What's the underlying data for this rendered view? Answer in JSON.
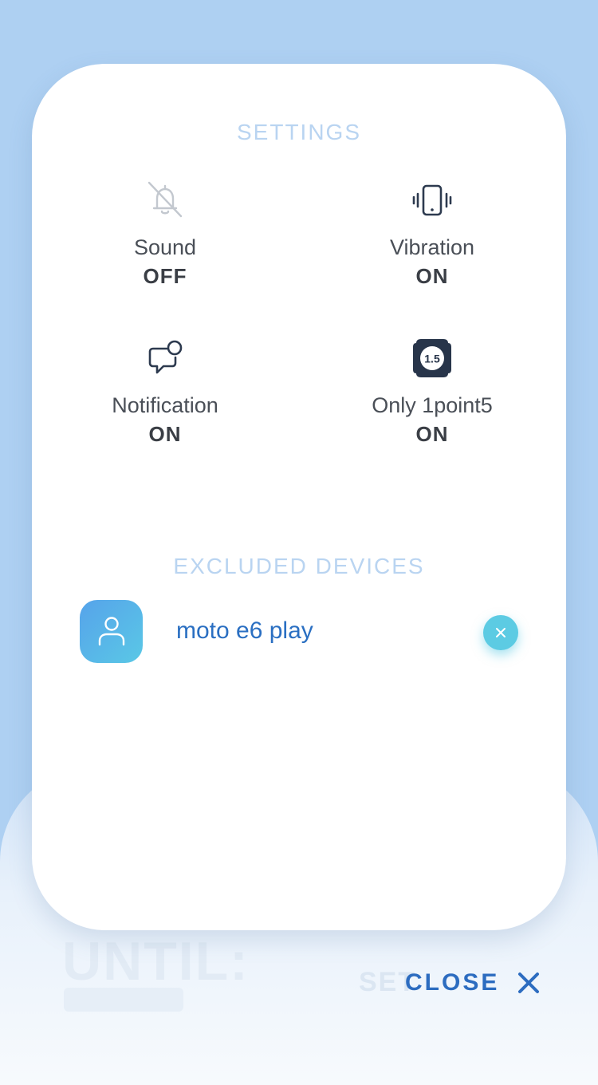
{
  "settings": {
    "title": "SETTINGS",
    "items": [
      {
        "label": "Sound",
        "value": "OFF",
        "icon": "bell-off-icon"
      },
      {
        "label": "Vibration",
        "value": "ON",
        "icon": "phone-vibrate-icon"
      },
      {
        "label": "Notification",
        "value": "ON",
        "icon": "chat-notification-icon"
      },
      {
        "label": "Only 1point5",
        "value": "ON",
        "icon": "badge-1point5-icon",
        "badge_text": "1.5"
      }
    ]
  },
  "excluded": {
    "title": "EXCLUDED DEVICES",
    "devices": [
      {
        "name": "moto e6 play",
        "icon": "user-icon"
      }
    ]
  },
  "footer": {
    "close_label": "CLOSE"
  },
  "colors": {
    "background": "#aed0f2",
    "section_title": "#b9d4f1",
    "accent_blue": "#2c6cc0",
    "remove_button": "#5ccbe3"
  }
}
